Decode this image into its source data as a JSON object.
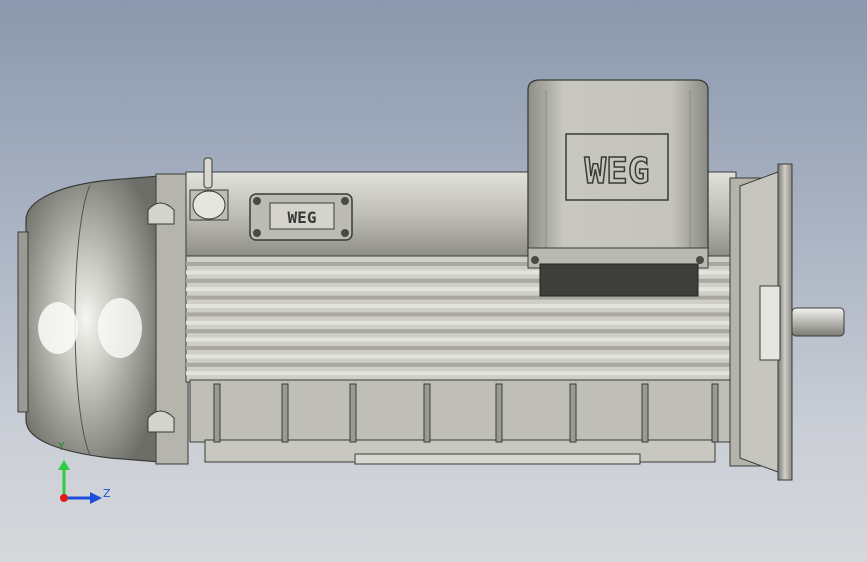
{
  "viewport": {
    "background_top": "#8b98ad",
    "background_bottom": "#d6d8dc"
  },
  "model": {
    "brand_logo_text": "WEG",
    "body_color": "#c4c4bc",
    "shadow_color": "#4a4a46",
    "terminal_box_color": "#bdbdb5"
  },
  "triad": {
    "y_label": "Y",
    "z_label": "Z",
    "y_color": "#2ecc40",
    "z_color": "#1f4fd8",
    "x_color": "#e01b1b"
  }
}
